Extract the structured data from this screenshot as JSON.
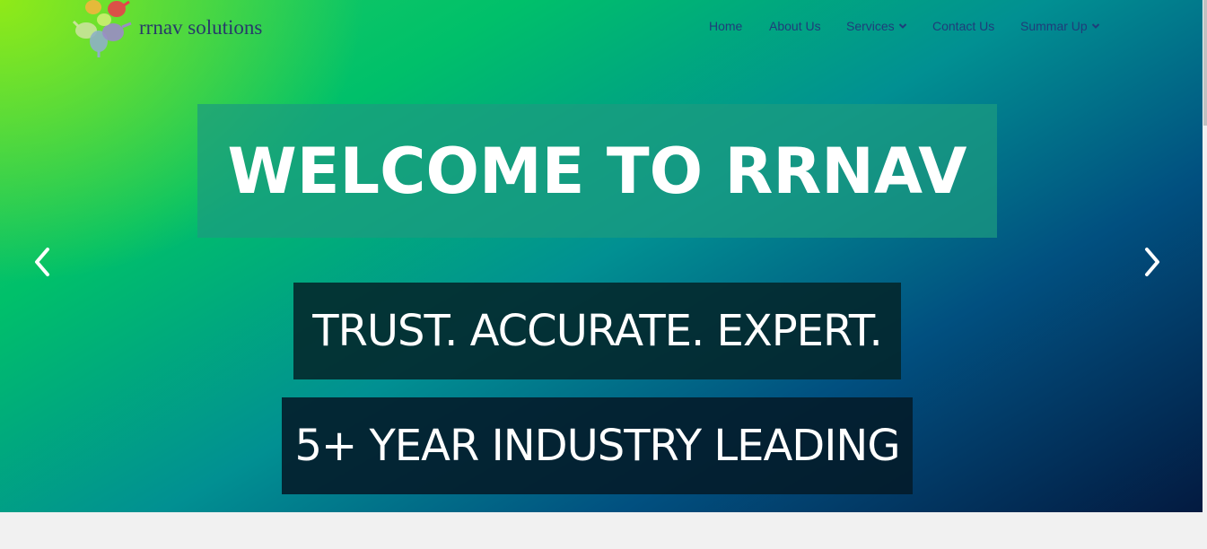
{
  "brand": {
    "name": "rrnav solutions",
    "colors": {
      "text": "#273a6a",
      "nav": "#1f3d7a"
    }
  },
  "nav": {
    "items": [
      {
        "label": "Home",
        "has_dropdown": false
      },
      {
        "label": "About Us",
        "has_dropdown": false
      },
      {
        "label": "Services",
        "has_dropdown": true
      },
      {
        "label": "Contact Us",
        "has_dropdown": false
      },
      {
        "label": "Summar Up",
        "has_dropdown": true
      }
    ]
  },
  "hero": {
    "title": "WELCOME TO RRNAV",
    "subtitle": "TRUST. ACCURATE. EXPERT.",
    "tagline": "5+ YEAR INDUSTRY LEADING",
    "prev_icon": "chevron-left-icon",
    "next_icon": "chevron-right-icon"
  }
}
